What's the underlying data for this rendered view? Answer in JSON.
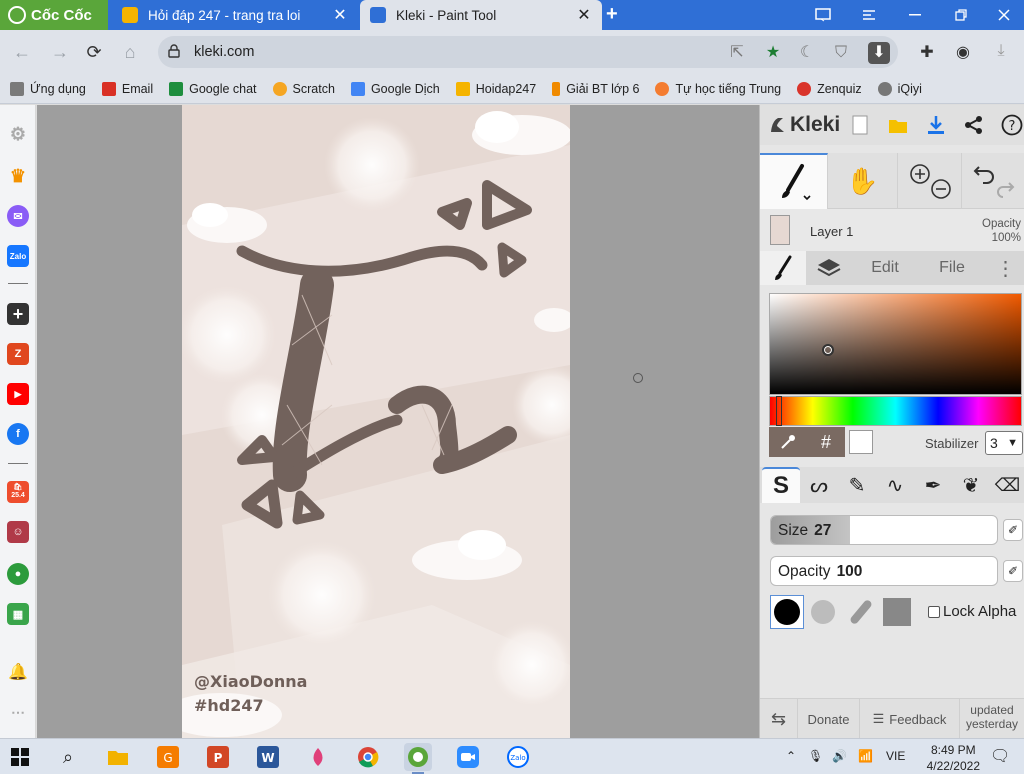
{
  "browser": {
    "brand": "Cốc Cốc",
    "tabs": [
      {
        "title": "Hỏi đáp 247 - trang tra loi",
        "close": "✕"
      },
      {
        "title": "Kleki - Paint Tool",
        "close": "✕"
      }
    ],
    "new_tab": "+",
    "url": "kleki.com"
  },
  "bookmarks": [
    {
      "label": "Ứng dụng",
      "color": "#7a7a7a"
    },
    {
      "label": "Email",
      "color": "#d93025"
    },
    {
      "label": "Google chat",
      "color": "#1e8e3e"
    },
    {
      "label": "Scratch",
      "color": "#f5a623"
    },
    {
      "label": "Google Dịch",
      "color": "#4285f4"
    },
    {
      "label": "Hoidap247",
      "color": "#f5b400"
    },
    {
      "label": "Giải BT lớp 6",
      "color": "#f08a00"
    },
    {
      "label": "Tự học tiếng Trung",
      "color": "#f47c30"
    },
    {
      "label": "Zenquiz",
      "color": "#d9342b"
    },
    {
      "label": "iQiyi",
      "color": "#777777"
    }
  ],
  "sidebar": {
    "shopee_badge": "25.4"
  },
  "artwork": {
    "watermark_name": "@XiaoDonna",
    "watermark_tag": "#hd247"
  },
  "kleki": {
    "logo": "Kleki",
    "layer": {
      "name": "Layer 1",
      "opacity_label": "Opacity",
      "opacity_value": "100%"
    },
    "tabs": {
      "edit": "Edit",
      "file": "File",
      "more": "⋮"
    },
    "hex_symbol": "#",
    "stabilizer_label": "Stabilizer",
    "stabilizer_value": "3",
    "size": {
      "label": "Size",
      "value": "27",
      "fraction": 0.35
    },
    "opacity": {
      "label": "Opacity",
      "value": "100",
      "fraction": 0.0
    },
    "lock_alpha": "Lock Alpha",
    "footer": {
      "donate": "Donate",
      "feedback": "Feedback",
      "updated_line1": "updated",
      "updated_line2": "yesterday"
    },
    "colors": {
      "accent": "#4a88d9",
      "current_color": "#000000",
      "secondary_color": "#ffffff"
    }
  },
  "taskbar": {
    "lang": "VIE",
    "time": "8:49 PM",
    "date": "4/22/2022"
  }
}
